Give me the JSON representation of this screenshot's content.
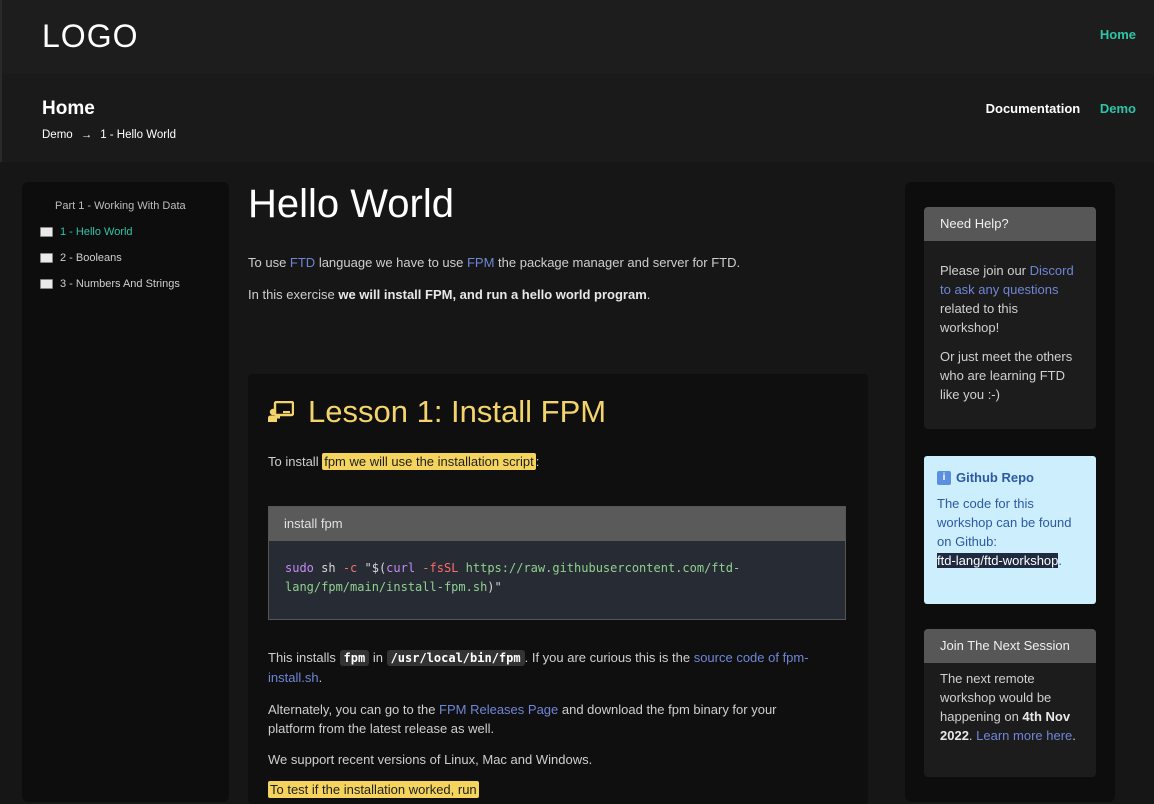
{
  "header": {
    "logo": "LOGO",
    "nav_home": "Home"
  },
  "section": {
    "title": "Home",
    "breadcrumb": [
      "Demo",
      "→",
      "1 - Hello World"
    ],
    "links": {
      "documentation": "Documentation",
      "demo": "Demo"
    }
  },
  "sidebar": {
    "part": "Part 1 - Working With Data",
    "items": [
      {
        "label": "1 - Hello World",
        "active": true
      },
      {
        "label": "2 - Booleans",
        "active": false
      },
      {
        "label": "3 - Numbers And Strings",
        "active": false
      }
    ]
  },
  "main": {
    "title": "Hello World",
    "intro": {
      "p1_a": "To use ",
      "p1_link1": "FTD",
      "p1_b": " language we have to use ",
      "p1_link2": "FPM",
      "p1_c": " the package manager and server for FTD.",
      "p2_a": "In this exercise ",
      "p2_bold": "we will install FPM, and run a hello world program",
      "p2_c": "."
    },
    "lesson": {
      "title": "Lesson 1: Install FPM",
      "install_a": "To install ",
      "install_hl": "fpm we will use the installation script",
      "install_c": ":",
      "code_head": "install fpm",
      "code": {
        "cmd": "sudo",
        "sh": " sh ",
        "flag": "-c",
        "q": " \"$(",
        "curl": "curl",
        "flag2": " -fsSL",
        "url1": " https://raw.githubusercontent.com/ftd-",
        "url2": "lang/fpm/main/install-fpm.sh",
        "end": ")\""
      },
      "p3_a": "This installs ",
      "p3_code1": "fpm",
      "p3_b": " in ",
      "p3_code2": "/usr/local/bin/fpm",
      "p3_c": ". If you are curious this is the ",
      "p3_link": "source code of fpm-",
      "p3_link2": "install.sh",
      "p3_d": ".",
      "p4_a": "Alternately, you can go to the ",
      "p4_link": "FPM Releases Page",
      "p4_b": " and download the fpm binary for your",
      "p4_c": "platform from the latest release as well.",
      "p5": "We support recent versions of Linux, Mac and Windows.",
      "p6_hl": "To test if the installation worked, run"
    }
  },
  "right": {
    "help": {
      "head": "Need Help?",
      "p1_a": "Please join our ",
      "p1_link": "Discord to ask any questions",
      "p1_b": " related to this workshop!",
      "p2": "Or just meet the others who are learning FTD like you :-)"
    },
    "repo": {
      "badge": "i",
      "title": "Github Repo",
      "text": "The code for this workshop can be found on Github:",
      "repo_link": "ftd-lang/ftd-workshop",
      "end": "."
    },
    "session": {
      "head": "Join The Next Session",
      "a": "The next remote workshop would be happening on ",
      "date": "4th Nov 2022",
      "b": ". ",
      "link": "Learn more here",
      "c": "."
    }
  },
  "colors": {
    "accent": "#2ec4a8",
    "lesson_title": "#f3d46b",
    "link": "#6f86d6",
    "highlight": "#f5d45e"
  }
}
